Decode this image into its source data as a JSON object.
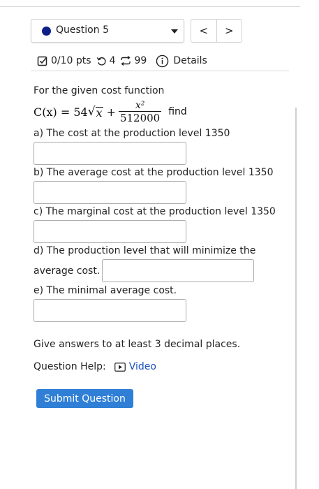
{
  "header": {
    "question_select": "Question 5",
    "nav": {
      "prev": "<",
      "next": ">"
    }
  },
  "meta": {
    "points": "0/10 pts",
    "retries": "4",
    "attempts": "99",
    "details": "Details"
  },
  "problem": {
    "intro": "For the given cost function",
    "formula_lhs": "C(x) = 54",
    "formula_sqrt": "x",
    "formula_plus": "+",
    "formula_num": "x²",
    "formula_den": "512000",
    "formula_tail": "find",
    "part_a": "a) The cost at the production level 1350",
    "part_b": "b) The average cost at the production level 1350",
    "part_c": "c) The marginal cost at the production level 1350",
    "part_d_line1": "d) The production level that will minimize the",
    "part_d_line2": "average cost.",
    "part_e": "e) The minimal average cost."
  },
  "inputs": {
    "a": "",
    "b": "",
    "c": "",
    "d": "",
    "e": ""
  },
  "footer": {
    "instructions": "Give answers to at least 3 decimal places.",
    "help_label": "Question Help:",
    "video_label": "Video",
    "submit_label": "Submit Question"
  },
  "colors": {
    "accent": "#2f7fd6",
    "link": "#1a4fbf",
    "question_dot": "#0e1f8a"
  }
}
